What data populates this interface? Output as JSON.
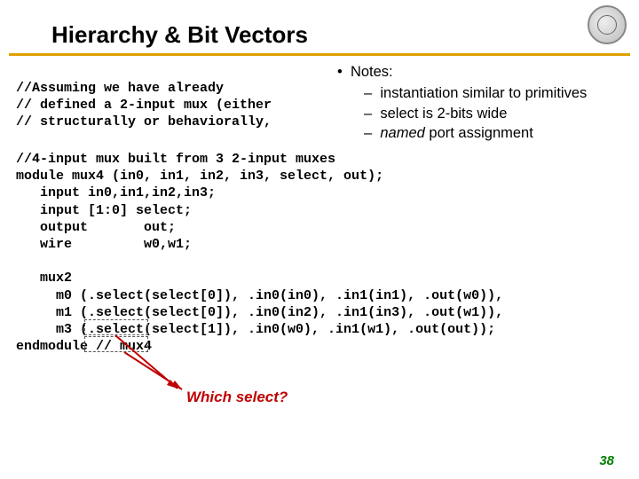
{
  "title": "Hierarchy & Bit Vectors",
  "notes": {
    "heading": "Notes:",
    "items": [
      "instantiation similar to primitives",
      "select is 2-bits wide",
      "named port assignment"
    ],
    "italic_word": "named"
  },
  "code_assume": "//Assuming we have already\n// defined a 2-input mux (either\n// structurally or behaviorally,",
  "code_main": "//4-input mux built from 3 2-input muxes\nmodule mux4 (in0, in1, in2, in3, select, out);\n   input in0,in1,in2,in3;\n   input [1:0] select;\n   output       out;\n   wire         w0,w1;\n\n   mux2\n     m0 (.select(select[0]), .in0(in0), .in1(in1), .out(w0)),\n     m1 (.select(select[0]), .in0(in2), .in1(in3), .out(w1)),\n     m3 (.select(select[1]), .in0(w0), .in1(w1), .out(out));\nendmodule // mux4",
  "callout": "Which select?",
  "page_number": "38"
}
